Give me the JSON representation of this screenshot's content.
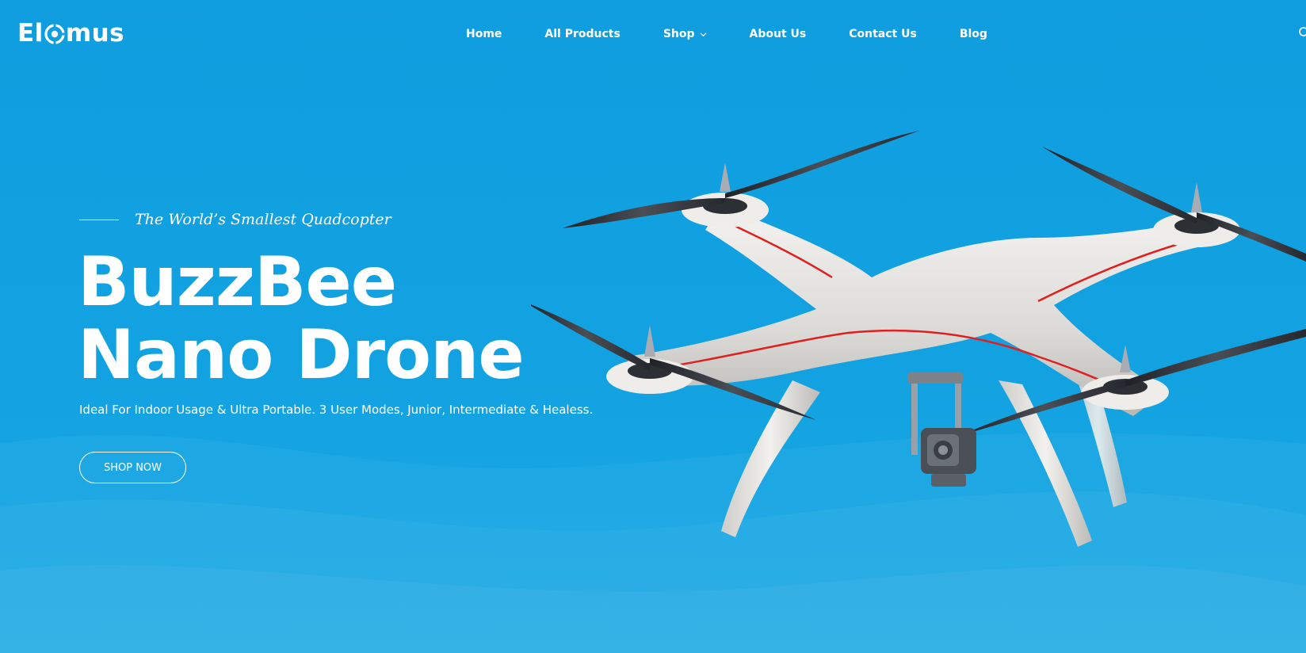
{
  "header": {
    "logo_text_left": "El",
    "logo_text_right": "mus",
    "nav": [
      {
        "label": "Home"
      },
      {
        "label": "All Products"
      },
      {
        "label": "Shop",
        "has_dropdown": true
      },
      {
        "label": "About Us"
      },
      {
        "label": "Contact Us"
      },
      {
        "label": "Blog"
      }
    ],
    "icons": {
      "logo_o": "aperture-icon",
      "shop_chevron": "chevron-down-icon",
      "search": "search-icon"
    }
  },
  "hero": {
    "tagline": "The World’s Smallest Quadcopter",
    "headline_line1": "BuzzBee",
    "headline_line2": "Nano Drone",
    "description": "Ideal For Indoor Usage & Ultra Portable. 3 User Modes, Junior, Intermediate & Healess.",
    "cta_label": "SHOP NOW",
    "image": "quadcopter-drone-image"
  },
  "colors": {
    "background": "#11a1e2",
    "text": "#ffffff",
    "drone_body": "#e8e8e6",
    "drone_accent": "#e02020",
    "propeller": "#2a2d33"
  }
}
